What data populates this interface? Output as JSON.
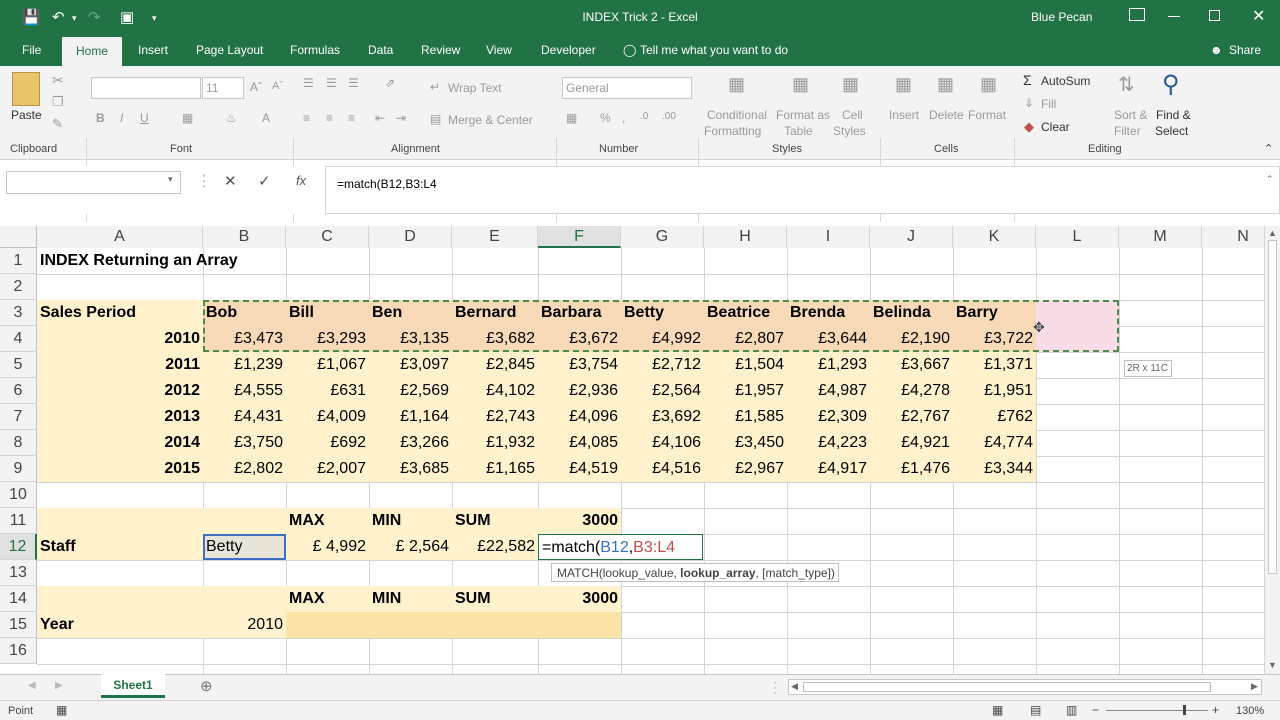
{
  "app": {
    "title": "INDEX Trick 2 - Excel",
    "user": "Blue Pecan"
  },
  "tabs": [
    "File",
    "Home",
    "Insert",
    "Page Layout",
    "Formulas",
    "Data",
    "Review",
    "View",
    "Developer"
  ],
  "tell_me": "Tell me what you want to do",
  "share": "Share",
  "ribbon": {
    "paste": "Paste",
    "clipboard": "Clipboard",
    "font_size": "11",
    "font": "Font",
    "wrap_text": "Wrap Text",
    "merge_center": "Merge & Center",
    "alignment": "Alignment",
    "number_format": "General",
    "number": "Number",
    "cond_format": "Conditional",
    "cond_format2": "Formatting",
    "format_as": "Format as",
    "format_as2": "Table",
    "cell_styles": "Cell",
    "cell_styles2": "Styles",
    "styles": "Styles",
    "insert": "Insert",
    "delete": "Delete",
    "format": "Format",
    "cells": "Cells",
    "autosum": "AutoSum",
    "fill": "Fill",
    "clear": "Clear",
    "sort": "Sort &",
    "sort2": "Filter",
    "find": "Find &",
    "find2": "Select",
    "editing": "Editing"
  },
  "formula_bar": {
    "name_box": "",
    "formula": "=match(B12,B3:L4"
  },
  "columns": [
    "A",
    "B",
    "C",
    "D",
    "E",
    "F",
    "G",
    "H",
    "I",
    "J",
    "K",
    "L",
    "M",
    "N"
  ],
  "rows": [
    "1",
    "2",
    "3",
    "4",
    "5",
    "6",
    "7",
    "8",
    "9",
    "10",
    "11",
    "12",
    "13",
    "14",
    "15",
    "16"
  ],
  "sheet": {
    "title": "INDEX Returning an Array",
    "sales_period": "Sales Period",
    "names": [
      "Bob",
      "Bill",
      "Ben",
      "Bernard",
      "Barbara",
      "Betty",
      "Beatrice",
      "Brenda",
      "Belinda",
      "Barry"
    ],
    "years": [
      "2010",
      "2011",
      "2012",
      "2013",
      "2014",
      "2015"
    ],
    "values": [
      [
        "£3,473",
        "£3,293",
        "£3,135",
        "£3,682",
        "£3,672",
        "£4,992",
        "£2,807",
        "£3,644",
        "£2,190",
        "£3,722"
      ],
      [
        "£1,239",
        "£1,067",
        "£3,097",
        "£2,845",
        "£3,754",
        "£2,712",
        "£1,504",
        "£1,293",
        "£3,667",
        "£1,371"
      ],
      [
        "£4,555",
        "£631",
        "£2,569",
        "£4,102",
        "£2,936",
        "£2,564",
        "£1,957",
        "£4,987",
        "£4,278",
        "£1,951"
      ],
      [
        "£4,431",
        "£4,009",
        "£1,164",
        "£2,743",
        "£4,096",
        "£3,692",
        "£1,585",
        "£2,309",
        "£2,767",
        "£762"
      ],
      [
        "£3,750",
        "£692",
        "£3,266",
        "£1,932",
        "£4,085",
        "£4,106",
        "£3,450",
        "£4,223",
        "£4,921",
        "£4,774"
      ],
      [
        "£2,802",
        "£2,007",
        "£3,685",
        "£1,165",
        "£4,519",
        "£4,516",
        "£2,967",
        "£4,917",
        "£1,476",
        "£3,344"
      ]
    ],
    "max": "MAX",
    "min": "MIN",
    "sum": "SUM",
    "threshold": "3000",
    "staff": "Staff",
    "staff_value": "Betty",
    "staff_max": "£  4,992",
    "staff_min": "£  2,564",
    "staff_sum": "£22,582",
    "edit_formula_prefix": "=match(",
    "edit_ref1": "B12",
    "edit_comma": ",",
    "edit_ref2": "B3:L4",
    "year": "Year",
    "year_value": "2010",
    "tooltip_a": "MATCH(lookup_value, ",
    "tooltip_b": "lookup_array",
    ", tooltip_c": "",
    "tooltip_c2": ", [match_type])",
    "size_hint": "2R x 11C"
  },
  "sheet_tab": "Sheet1",
  "status": {
    "mode": "Point",
    "zoom": "130%"
  }
}
